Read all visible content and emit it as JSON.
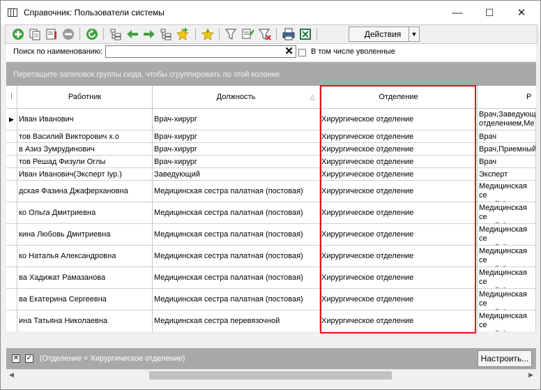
{
  "window": {
    "title": "Справочник: Пользователи системы",
    "minimize": "—",
    "maximize": "☐",
    "close": "✕"
  },
  "toolbar": {
    "actions_label": "Действия",
    "actions_dropdown": "▼"
  },
  "search": {
    "label": "Поиск по наименованию:",
    "value": "",
    "clear": "✕",
    "include_fired_label": "В том числе уволенные",
    "include_fired_checked": false
  },
  "group_panel": {
    "hint": "Перетащите заголовок группы сюда, чтобы сгруппировать по этой колонке"
  },
  "grid": {
    "columns": {
      "worker": "Работник",
      "position": "Должность",
      "department": "Отделение",
      "role": "Р"
    },
    "sort_indicator": "△",
    "rows": [
      {
        "worker": "Иван Иванович",
        "position": "Врач-хирург",
        "department": "Хирургическое отделение",
        "role": "Врач,Заведующ отделением,Ме",
        "current": true
      },
      {
        "worker": "тов Василий Викторович х.о",
        "position": "Врач-хирург",
        "department": "Хирургическое отделение",
        "role": "Врач"
      },
      {
        "worker": "в Азиз Зумрудинович",
        "position": "Врач-хирург",
        "department": "Хирургическое отделение",
        "role": "Врач,Приемный"
      },
      {
        "worker": "тов Решад Физули Оглы",
        "position": "Врач-хирург",
        "department": "Хирургическое отделение",
        "role": "Врач"
      },
      {
        "worker": " Иван Иванович(Эксперт Iур.)",
        "position": "Заведующий",
        "department": "Хирургическое отделение",
        "role": "Эксперт"
      },
      {
        "worker": "дская Фазина Джаферхановна",
        "position": "Медицинская сестра палатная (постовая)",
        "department": "Хирургическое отделение",
        "role": "Медицинская се покой,Статисти"
      },
      {
        "worker": "ко Ольга Дмитриевна",
        "position": "Медицинская сестра палатная (постовая)",
        "department": "Хирургическое отделение",
        "role": "Медицинская се покой,Статисти"
      },
      {
        "worker": "кина Любовь Дмитриевна",
        "position": "Медицинская сестра палатная (постовая)",
        "department": "Хирургическое отделение",
        "role": "Медицинская се покой,Статисти"
      },
      {
        "worker": "ко Наталья Александровна",
        "position": "Медицинская сестра палатная (постовая)",
        "department": "Хирургическое отделение",
        "role": "Медицинская се покой,Статисти"
      },
      {
        "worker": "ва Хадижат Рамазанова",
        "position": "Медицинская сестра палатная (постовая)",
        "department": "Хирургическое отделение",
        "role": "Медицинская се покой,Статисти"
      },
      {
        "worker": "ва Екатерина Сергеевна",
        "position": "Медицинская сестра палатная (постовая)",
        "department": "Хирургическое отделение",
        "role": "Медицинская се покой,Статисти"
      },
      {
        "worker": "ина Татьяна Николаевна",
        "position": "Медицинская сестра перевязочной",
        "department": "Хирургическое отделение",
        "role": "Медицинская се покой,Статисти"
      }
    ]
  },
  "filter_bar": {
    "text": "(Отделение = Хирургическое отделение)",
    "close": "✕",
    "enabled_mark": "✓",
    "settings_label": "Настроить..."
  },
  "highlight": {
    "color": "#e0141e"
  }
}
